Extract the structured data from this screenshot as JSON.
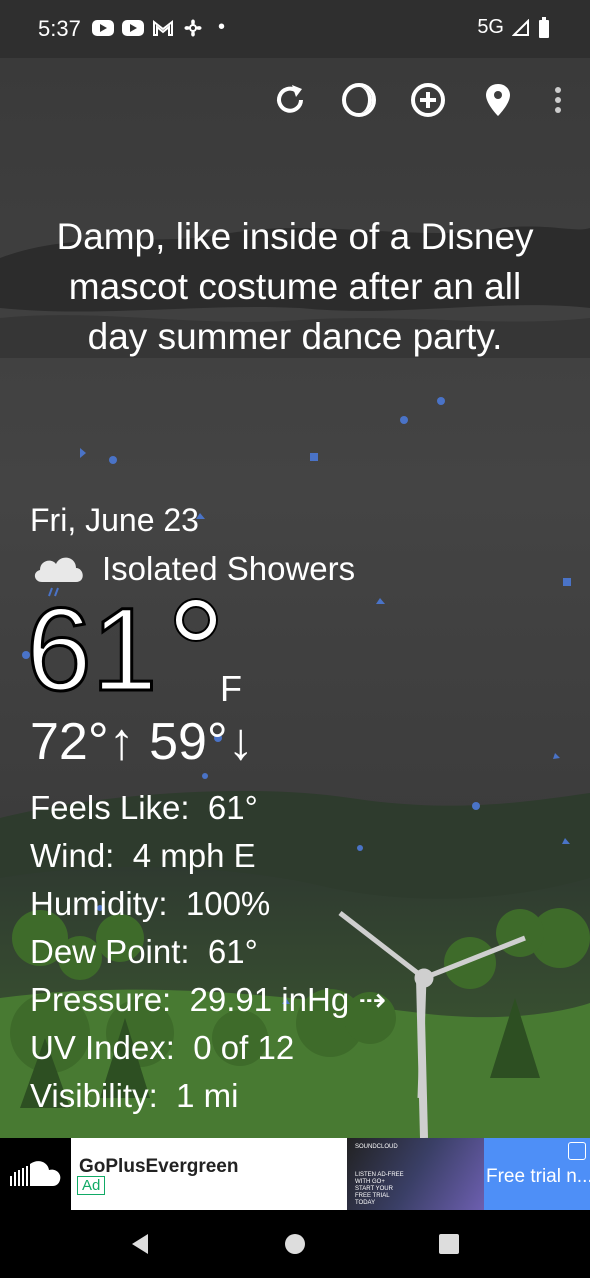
{
  "status": {
    "time": "5:37",
    "network": "5G"
  },
  "toolbar": {
    "refresh_icon": "refresh-icon",
    "theme_icon": "moon-icon",
    "add_icon": "add-location-icon",
    "location_icon": "location-pin-icon",
    "more_icon": "more-vert-icon"
  },
  "quote": "Damp, like inside of a Disney mascot costume after an all day summer dance party.",
  "weather": {
    "date": "Fri, June 23",
    "condition": "Isolated Showers",
    "temp": "61",
    "unit": "F",
    "hilo": "72°↑ 59°↓",
    "details": [
      {
        "label": "Feels Like:",
        "value": "61°"
      },
      {
        "label": "Wind:",
        "value": "4 mph E"
      },
      {
        "label": "Humidity:",
        "value": "100%"
      },
      {
        "label": "Dew Point:",
        "value": "61°"
      },
      {
        "label": "Pressure:",
        "value": "29.91 inHg ⇢"
      },
      {
        "label": "UV Index:",
        "value": "0 of 12"
      },
      {
        "label": "Visibility:",
        "value": "1 mi"
      }
    ]
  },
  "ad": {
    "advertiser": "GoPlusEvergreen",
    "badge": "Ad",
    "image_brand": "SOUNDCLOUD",
    "image_text": "LISTEN AD-FREE WITH GO+ START YOUR FREE TRIAL TODAY",
    "cta": "Free trial n..."
  },
  "colors": {
    "sky": "#3d3d3d",
    "hills": "#3f5a3a",
    "rain": "#4a73c7",
    "ad_cta": "#4e8ff7"
  }
}
